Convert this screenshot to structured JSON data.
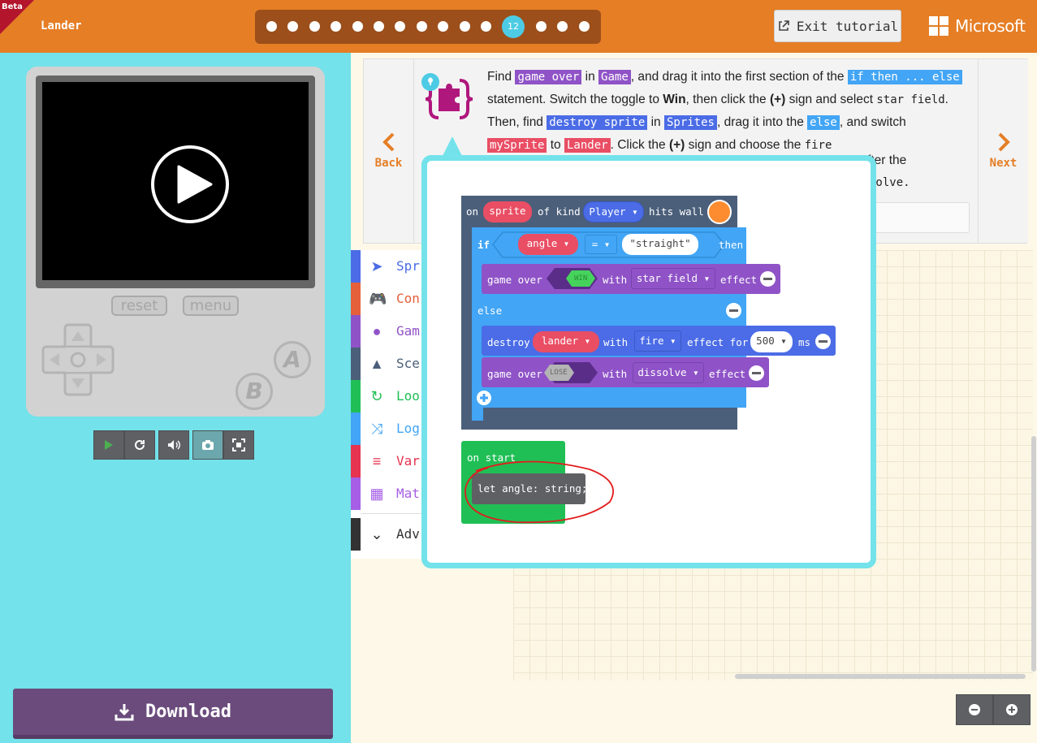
{
  "header": {
    "beta_label": "Beta",
    "project_name": "Lander",
    "current_step": "12",
    "exit_label": "Exit tutorial",
    "brand": "Microsoft"
  },
  "simulator": {
    "reset_label": "reset",
    "menu_label": "menu",
    "button_a": "A",
    "button_b": "B"
  },
  "download_label": "Download",
  "tutorial": {
    "back_label": "Back",
    "next_label": "Next",
    "t1": "Find",
    "c_game_over": "game over",
    "t2": "in",
    "c_game": "Game",
    "t3": ", and drag it into the first section of the",
    "c_if_then_else": "if then ... else",
    "t4": "statement. Switch the toggle to",
    "b_win": "Win",
    "t5": ", then click the",
    "b_plus": "(+)",
    "t6": "sign and select",
    "code_star_field": "star field",
    "t7": ". Then, find",
    "c_destroy_sprite": "destroy sprite",
    "t8": "in",
    "c_sprites": "Sprites",
    "t9": ", drag it into the",
    "c_else": "else",
    "t10": ", and switch",
    "c_mysprite": "mySprite",
    "t11": "to",
    "c_lander": "Lander",
    "t12": ". Click the",
    "b_plus2": "(+)",
    "t13": "sign and choose the",
    "code_fire": "fire",
    "t14": "fter the",
    "code_solve": "solve",
    "t15": "."
  },
  "toolbox": [
    {
      "label": "Spr",
      "color": "#4b6ce6",
      "icon": "paper-plane-icon"
    },
    {
      "label": "Con",
      "color": "#e5603b",
      "icon": "gamepad-icon"
    },
    {
      "label": "Gam",
      "color": "#8f53c7",
      "icon": "circle-icon"
    },
    {
      "label": "Sce",
      "color": "#4b5f7a",
      "icon": "tree-icon"
    },
    {
      "label": "Loo",
      "color": "#20bf55",
      "icon": "refresh-icon"
    },
    {
      "label": "Log",
      "color": "#42a5f5",
      "icon": "shuffle-icon"
    },
    {
      "label": "Var",
      "color": "#e6334f",
      "icon": "list-icon"
    },
    {
      "label": "Mat",
      "color": "#a65ee6",
      "icon": "calculator-icon"
    },
    {
      "label": "Adv",
      "color": "#333333",
      "icon": "chevron-down-icon"
    }
  ],
  "blocks": {
    "on": "on",
    "sprite": "sprite",
    "of_kind": "of kind",
    "player": "Player",
    "hits_wall": "hits wall",
    "if": "if",
    "angle": "angle",
    "eq": "=",
    "straight": "\"straight\"",
    "then": "then",
    "game_over": "game over",
    "win": "WIN",
    "with": "with",
    "star_field": "star field",
    "effect": "effect",
    "else": "else",
    "destroy": "destroy",
    "lander": "lander",
    "fire": "fire",
    "effect_for": "effect for",
    "ms_value": "500",
    "ms": "ms",
    "lose": "LOSE",
    "dissolve": "dissolve",
    "on_start": "on start",
    "let_angle": "let angle: string;"
  },
  "colors": {
    "header": "#e57e25",
    "simulator_bg": "#73e2ea",
    "events_block": "#4b5f7a",
    "logic_block": "#42a5f5",
    "game_block": "#8f53c7",
    "loops_block": "#20bf55",
    "variable_pill": "#e94e64"
  }
}
